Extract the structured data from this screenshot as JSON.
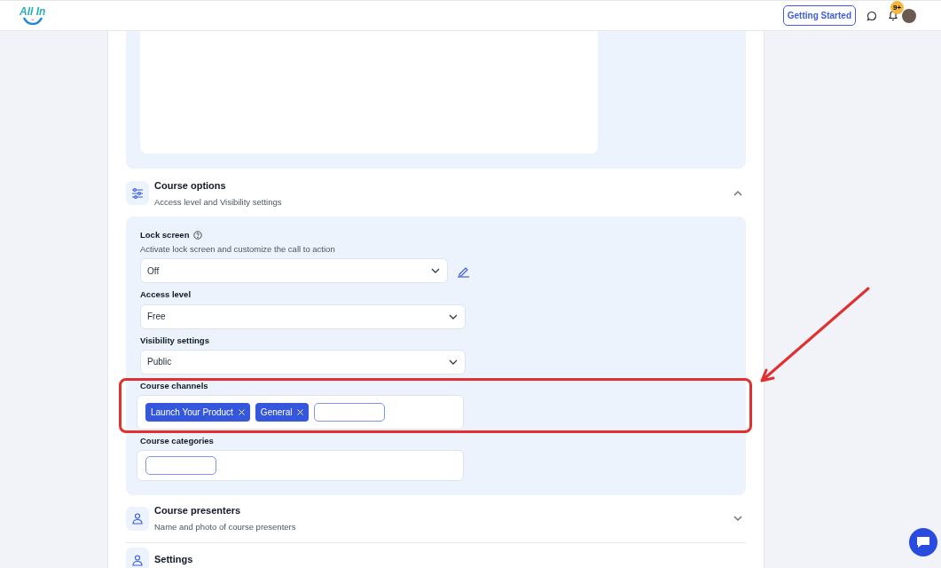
{
  "header": {
    "logo_text": "All In",
    "getting_started": "Getting Started",
    "notification_badge": "9+"
  },
  "sections": [
    {
      "kind": "options",
      "title": "Course options",
      "subtitle": "Access level and Visibility settings",
      "expanded": true,
      "fields": [
        {
          "kind": "select",
          "label": "Lock screen",
          "help": true,
          "description": "Activate lock screen and customize the call to action",
          "value": "Off",
          "editable": true
        },
        {
          "kind": "select",
          "label": "Access level",
          "value": "Free"
        },
        {
          "kind": "select",
          "label": "Visibility settings",
          "value": "Public"
        },
        {
          "kind": "tags",
          "label": "Course channels",
          "tags": [
            "Launch Your Product",
            "General"
          ],
          "highlighted": true
        },
        {
          "kind": "tags",
          "label": "Course categories",
          "highlighted": false
        }
      ]
    },
    {
      "kind": "presenters",
      "title": "Course presenters",
      "subtitle": "Name and photo of course presenters",
      "expanded": false
    },
    {
      "kind": "settings",
      "title": "Settings"
    }
  ]
}
